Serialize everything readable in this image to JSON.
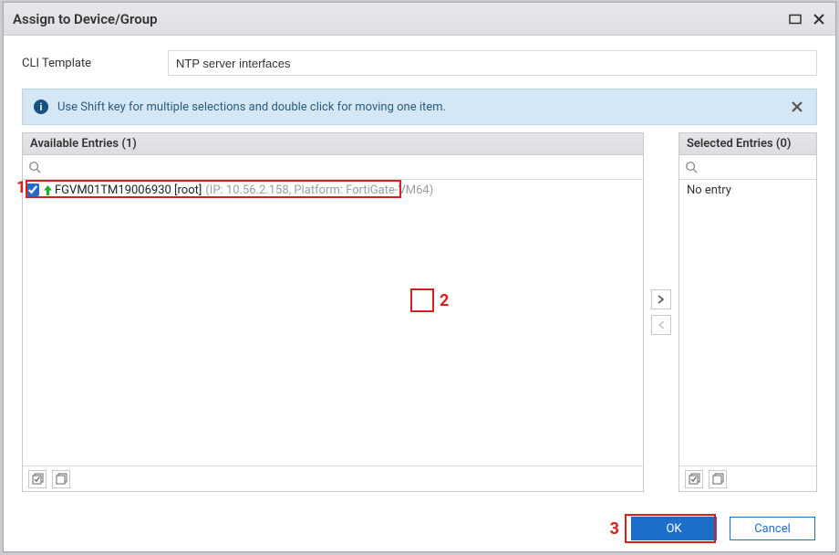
{
  "dialog": {
    "title": "Assign to Device/Group"
  },
  "form": {
    "cli_template_label": "CLI Template",
    "cli_template_value": "NTP server interfaces"
  },
  "info": {
    "text": "Use Shift key for multiple selections and double click for moving one item."
  },
  "available": {
    "title": "Available Entries (1)",
    "entry": {
      "name": "FGVM01TM19006930 [root]",
      "meta": "(IP: 10.56.2.158, Platform: FortiGate-VM64)",
      "checked": true
    }
  },
  "selected": {
    "title": "Selected Entries (0)",
    "no_entry": "No entry"
  },
  "buttons": {
    "ok": "OK",
    "cancel": "Cancel"
  },
  "annotations": {
    "a1": "1",
    "a2": "2",
    "a3": "3"
  }
}
